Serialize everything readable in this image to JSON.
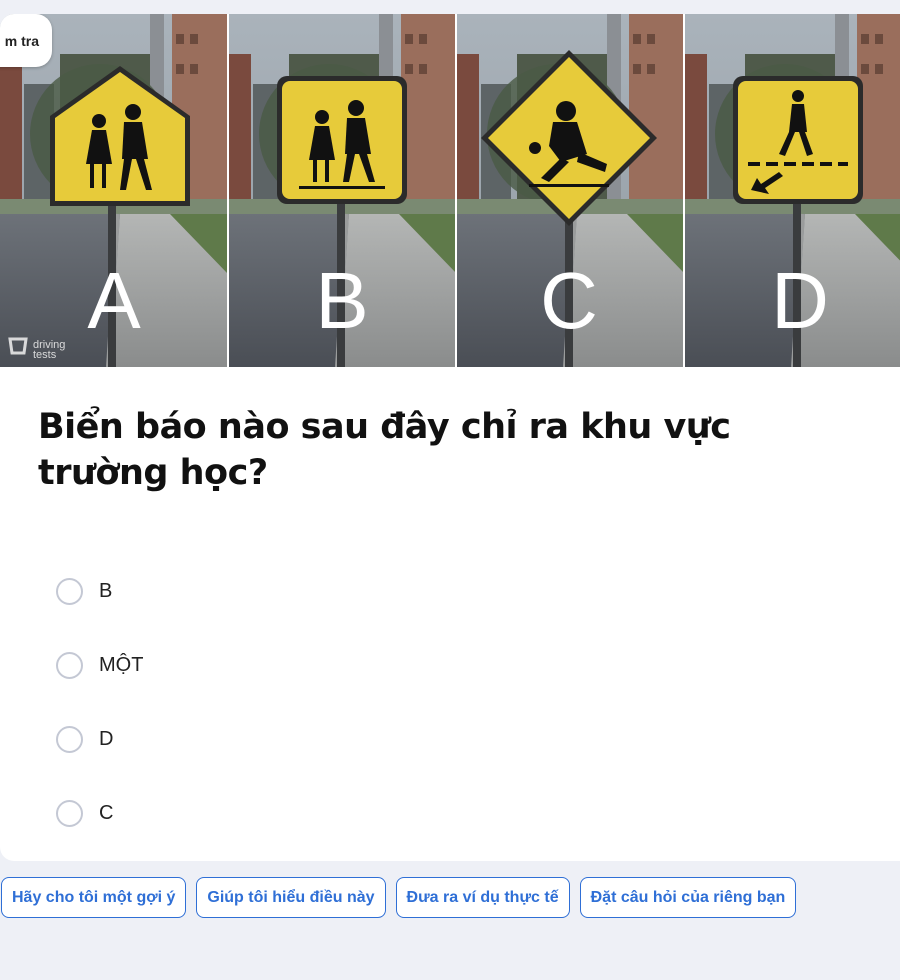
{
  "badge": {
    "label": "m tra"
  },
  "image": {
    "watermark": {
      "line1": "driving",
      "line2": "tests"
    },
    "panels": [
      {
        "letter": "A",
        "sign": "school-children-pentagon-sign"
      },
      {
        "letter": "B",
        "sign": "school-children-square-sign"
      },
      {
        "letter": "C",
        "sign": "playground-diamond-sign"
      },
      {
        "letter": "D",
        "sign": "pedestrian-crossing-sign"
      }
    ]
  },
  "question": {
    "text": "Biển báo nào sau đây chỉ ra khu vực trường học?"
  },
  "options": [
    {
      "label": "B"
    },
    {
      "label": "MỘT"
    },
    {
      "label": "D"
    },
    {
      "label": "C"
    }
  ],
  "actions": [
    {
      "label": "Hãy cho tôi một gợi ý"
    },
    {
      "label": "Giúp tôi hiểu điều này"
    },
    {
      "label": "Đưa ra ví dụ thực tế"
    },
    {
      "label": "Đặt câu hỏi của riêng bạn"
    }
  ],
  "colors": {
    "accent": "#2f6fd6",
    "sign_yellow": "#e7cb3a",
    "background": "#eef0f6"
  }
}
